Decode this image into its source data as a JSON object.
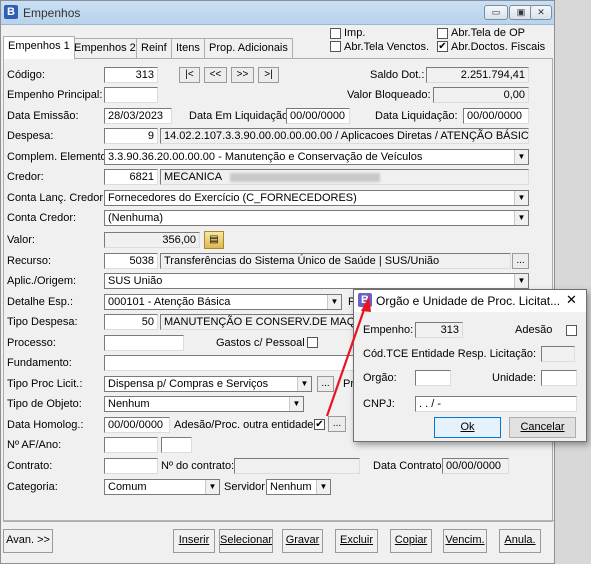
{
  "window": {
    "title": "Empenhos"
  },
  "top_checks": {
    "imp": "Imp.",
    "abr_tela_vencimentos": "Abr.Tela Venctos.",
    "abr_tela_op": "Abr.Tela de OP",
    "abr_doctos_fiscais": "Abr.Doctos. Fiscais"
  },
  "tabs": [
    "Empenhos 1",
    "Empenhos 2",
    "Reinf",
    "Itens",
    "Prop. Adicionais"
  ],
  "nav": [
    "|<",
    "<<",
    ">>",
    ">|"
  ],
  "form": {
    "codigo_label": "Código:",
    "codigo": "313",
    "empenho_principal_label": "Empenho Principal:",
    "saldo_dot_label": "Saldo Dot.:",
    "saldo_dot": "2.251.794,41",
    "valor_bloqueado_label": "Valor Bloqueado:",
    "valor_bloqueado": "0,00",
    "data_emissao_label": "Data Emissão:",
    "data_emissao": "28/03/2023",
    "data_em_liquidacao_label": "Data Em Liquidação:",
    "data_em_liquidacao": "00/00/0000",
    "data_liquidacao_label": "Data Liquidação:",
    "data_liquidacao": "00/00/0000",
    "despesa_label": "Despesa:",
    "despesa_code": "9",
    "despesa_desc": "14.02.2.107.3.3.90.00.00.00.00.00 / Aplicacoes Diretas / ATENÇÃO BÁSICA",
    "complem_elemento_label": "Complem. Elemento:",
    "complem_elemento": "3.3.90.36.20.00.00.00 - Manutenção e Conservação de Veículos",
    "credor_label": "Credor:",
    "credor_code": "6821",
    "credor_name": "MECANICA",
    "conta_lanc_credor_label": "Conta Lanç. Credor:",
    "conta_lanc_credor": "Fornecedores do Exercício (C_FORNECEDORES)",
    "conta_credor_label": "Conta Credor:",
    "conta_credor": "(Nenhuma)",
    "valor_label": "Valor:",
    "valor": "356,00",
    "recurso_label": "Recurso:",
    "recurso_code": "5038",
    "recurso_desc": "Transferências do Sistema Único de Saúde | SUS/União",
    "aplic_origem_label": "Aplic./Origem:",
    "aplic_origem": "SUS União",
    "detalhe_esp_label": "Detalhe Esp.:",
    "detalhe_esp": "000101 - Atenção Básica",
    "tipo_despesa_label": "Tipo Despesa:",
    "tipo_despesa_code": "50",
    "tipo_despesa_desc": "MANUTENÇÃO E CONSERV.DE MAQ",
    "processo_label": "Processo:",
    "gastos_pessoal_label": "Gastos c/ Pessoal",
    "fundamento_label": "Fundamento:",
    "tipo_proc_licit_label": "Tipo Proc Licit.:",
    "tipo_proc_licit": "Dispensa p/ Compras e Serviços",
    "tipo_objeto_label": "Tipo de Objeto:",
    "tipo_objeto": "Nenhum",
    "data_homolog_label": "Data Homolog.:",
    "data_homolog": "00/00/0000",
    "adesao_outra_entidade_label": "Adesão/Proc. outra entidade",
    "af_ano_label": "Nº AF/Ano:",
    "contrato_label": "Contrato:",
    "n_contrato_label": "Nº do contrato:",
    "data_contrato_label": "Data Contrato:",
    "data_contrato": "00/00/0000",
    "categoria_label": "Categoria:",
    "categoria": "Comum",
    "servidor_label": "Servidor:",
    "servidor": "Nenhum",
    "truncated_p1": "P",
    "truncated_p2": "Pr"
  },
  "buttons": {
    "avancar": "Avan. >>",
    "inserir": "Inserir",
    "selecionar": "Selecionar",
    "gravar": "Gravar",
    "excluir": "Excluir",
    "copiar": "Copiar",
    "vencim": "Vencim.",
    "anula": "Anula."
  },
  "dialog": {
    "title": "Orgão e Unidade de Proc. Licitat...",
    "empenho_label": "Empenho:",
    "empenho": "313",
    "adesao_label": "Adesão",
    "cod_tce_label": "Cód.TCE Entidade Resp. Licitação:",
    "orgao_label": "Orgão:",
    "unidade_label": "Unidade:",
    "cnpj_label": "CNPJ:",
    "cnpj": ". . / -",
    "ok": "Ok",
    "cancelar": "Cancelar"
  },
  "colors": {
    "annotation_arrow": "#e8141e",
    "titlebar": "#c9dff3"
  }
}
